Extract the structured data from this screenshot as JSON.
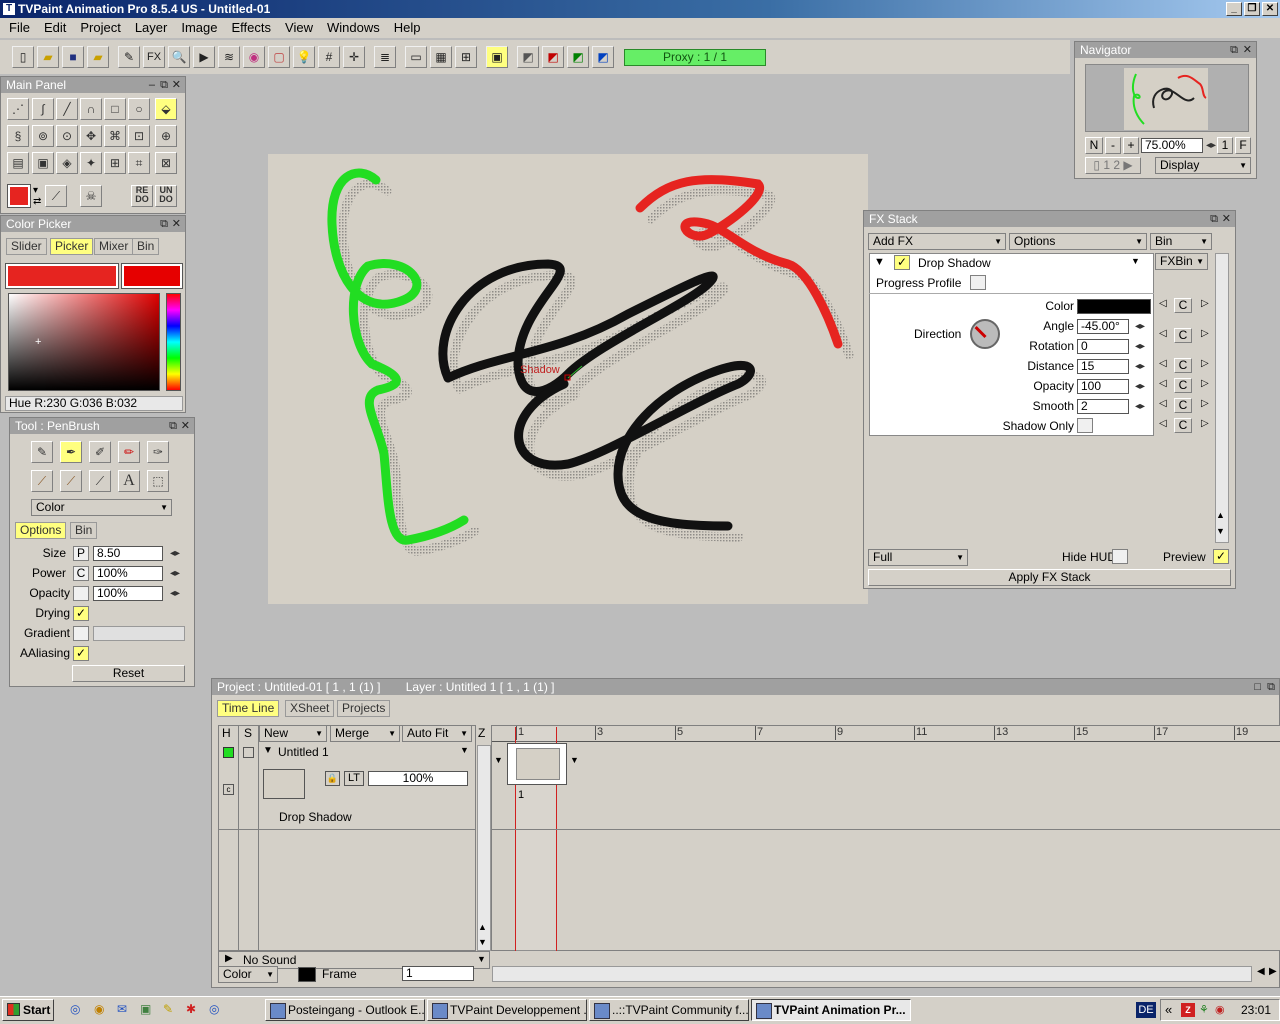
{
  "window": {
    "title": "TVPaint Animation Pro 8.5.4 US - Untitled-01"
  },
  "menu": [
    "File",
    "Edit",
    "Project",
    "Layer",
    "Image",
    "Effects",
    "View",
    "Windows",
    "Help"
  ],
  "toolbar": {
    "proxy": "Proxy : 1 / 1",
    "fx": "FX"
  },
  "navigator": {
    "title": "Navigator",
    "zoom": "75.00%",
    "n_btn": "N",
    "minus_btn": "-",
    "plus_btn": "+",
    "one_btn": "1",
    "f_btn": "F",
    "display": "Display"
  },
  "main_panel": {
    "title": "Main Panel",
    "redo": "RE DO",
    "undo": "UN DO"
  },
  "color_picker": {
    "title": "Color Picker",
    "tabs": [
      "Slider",
      "Picker",
      "Mixer",
      "Bin"
    ],
    "readout": "Hue R:230 G:036 B:032",
    "color": "#e62420"
  },
  "tool_panel": {
    "title": "Tool : PenBrush",
    "mode": "Color",
    "tabs": [
      "Options",
      "Bin"
    ],
    "size_label": "Size",
    "size_mode": "P",
    "size": "8.50",
    "power_label": "Power",
    "power_mode": "C",
    "power": "100%",
    "opacity_label": "Opacity",
    "opacity": "100%",
    "drying_label": "Drying",
    "gradient_label": "Gradient",
    "aaliasing_label": "AAliasing",
    "reset": "Reset"
  },
  "canvas": {
    "annotation": "Shadow"
  },
  "fx_stack": {
    "title": "FX Stack",
    "add_fx": "Add FX",
    "options": "Options",
    "bin": "Bin",
    "fxbin": "FXBin",
    "effect": "Drop Shadow",
    "progress_profile": "Progress Profile",
    "color_label": "Color",
    "direction_label": "Direction",
    "angle_label": "Angle",
    "angle": "-45.00°",
    "rotation_label": "Rotation",
    "rotation": "0",
    "distance_label": "Distance",
    "distance": "15",
    "opacity_label": "Opacity",
    "opacity": "100",
    "smooth_label": "Smooth",
    "smooth": "2",
    "shadow_only_label": "Shadow Only",
    "c": "C",
    "quality": "Full",
    "hide_hud": "Hide HUD",
    "preview": "Preview",
    "apply": "Apply FX Stack"
  },
  "timeline": {
    "project_info": "Project : Untitled-01 [ 1 , 1  (1) ]",
    "layer_info": "Layer : Untitled 1 [ 1 , 1  (1) ]",
    "tabs": [
      "Time Line",
      "XSheet",
      "Projects"
    ],
    "col_h": "H",
    "col_s": "S",
    "new": "New",
    "merge": "Merge",
    "auto_fit": "Auto Fit",
    "z": "Z",
    "layer_name": "Untitled 1",
    "lt": "LT",
    "layer_opacity": "100%",
    "layer_fx": "Drop Shadow",
    "frame_ticks": [
      "1",
      "3",
      "5",
      "7",
      "9",
      "11",
      "13",
      "15",
      "17",
      "19"
    ],
    "frame_num": "1",
    "no_sound": "No Sound",
    "color_mode": "Color",
    "frame_label": "Frame",
    "frame_value": "1"
  },
  "taskbar": {
    "start": "Start",
    "tasks": [
      "Posteingang - Outlook E...",
      "TVPaint Developpement ...",
      "..::TVPaint Community f...",
      "TVPaint Animation Pr..."
    ],
    "lang": "DE",
    "clock": "23:01"
  }
}
